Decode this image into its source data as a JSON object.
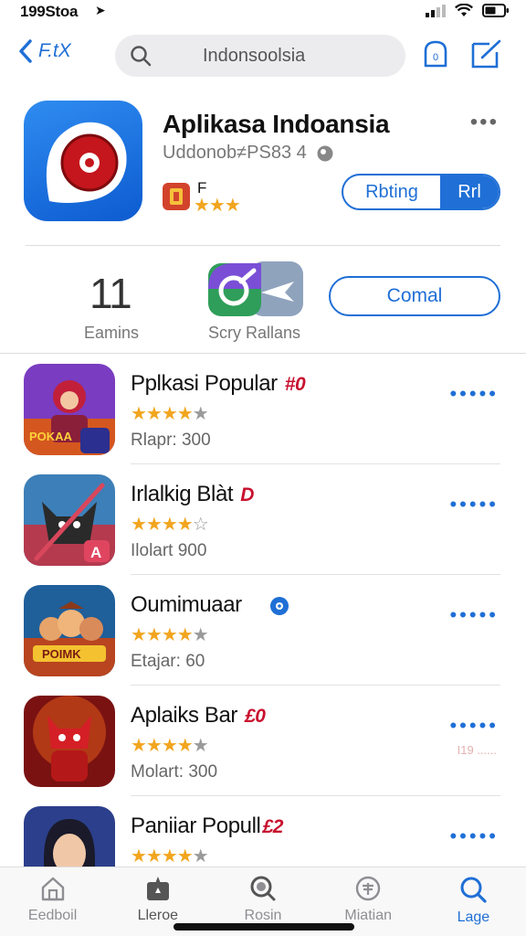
{
  "status": {
    "time": "199Stoa",
    "arrow": "➤"
  },
  "nav": {
    "back_label": "F.tX",
    "search_text": "Indonsoolsia"
  },
  "app": {
    "title": "Aplikasa Indoansia",
    "subtitle": "Uddonob≠PS83 4",
    "badge_letter": "F",
    "stars": "★★★",
    "rating_btn_left": "Rbting",
    "rating_btn_right": "Rrl",
    "more": "•••"
  },
  "stats": {
    "number": "11",
    "label1": "Eamins",
    "label2": "Scry Rallans",
    "button": "Comal"
  },
  "list": [
    {
      "title": "Pplkasi Popular",
      "badge": "#0",
      "meta": "Rlapr: 300",
      "stars_full": "★★★★",
      "stars_dim": "★",
      "dots": "•••••"
    },
    {
      "title": "Irlalkig Blàt",
      "badge": "D",
      "meta": "Ilolart 900",
      "stars_full": "★★★★",
      "stars_dim": "☆",
      "dots": "•••••"
    },
    {
      "title": "Oumimuaar",
      "badge": "",
      "meta": "Etajar: 60",
      "stars_full": "★★★★",
      "stars_dim": "★",
      "dots": "•••••"
    },
    {
      "title": "Aplaiks Bar",
      "badge": "£0",
      "meta": "Molart: 300",
      "stars_full": "★★★★",
      "stars_dim": "★",
      "dots": "•••••",
      "watermark": "I19 ......"
    },
    {
      "title": "Paniiar Popull",
      "badge": "£2",
      "meta": "",
      "stars_full": "★★★★",
      "stars_dim": "★",
      "dots": "•••••"
    }
  ],
  "tabs": [
    {
      "label": "Eedboil"
    },
    {
      "label": "Lleroe"
    },
    {
      "label": "Rosin"
    },
    {
      "label": "Miatian"
    },
    {
      "label": "Lage"
    }
  ]
}
